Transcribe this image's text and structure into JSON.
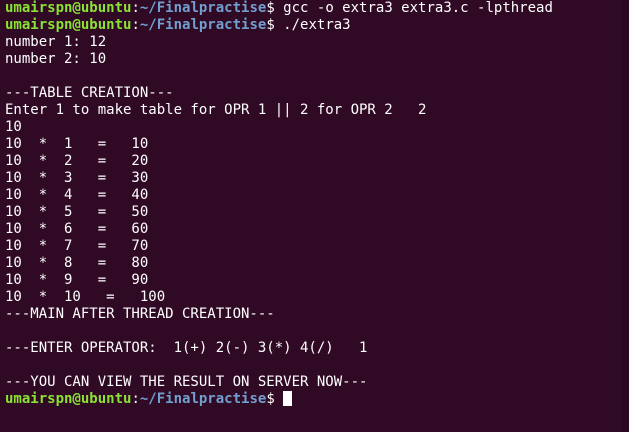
{
  "prompt": {
    "user_host": "umairspn@ubuntu",
    "sep": ":",
    "path": "~/Finalpractise",
    "symbol": "$"
  },
  "commands": {
    "c1": " gcc -o extra3 extra3.c -lpthread",
    "c2": " ./extra3"
  },
  "output": {
    "l1": "number 1: 12",
    "l2": "number 2: 10",
    "l3": "",
    "l4": "---TABLE CREATION---",
    "l5": "Enter 1 to make table for OPR 1 || 2 for OPR 2   2",
    "l6": "10",
    "t1": "10  *  1   =   10",
    "t2": "10  *  2   =   20",
    "t3": "10  *  3   =   30",
    "t4": "10  *  4   =   40",
    "t5": "10  *  5   =   50",
    "t6": "10  *  6   =   60",
    "t7": "10  *  7   =   70",
    "t8": "10  *  8   =   80",
    "t9": "10  *  9   =   90",
    "t10": "10  *  10   =   100",
    "l7": "---MAIN AFTER THREAD CREATION---",
    "l8": "",
    "l9": "---ENTER OPERATOR:  1(+) 2(-) 3(*) 4(/)   1",
    "l10": "",
    "l11": "---YOU CAN VIEW THE RESULT ON SERVER NOW---"
  },
  "colors": {
    "background": "#300a24",
    "prompt_user": "#8ae234",
    "prompt_path": "#729fcf",
    "text": "#ffffff"
  }
}
